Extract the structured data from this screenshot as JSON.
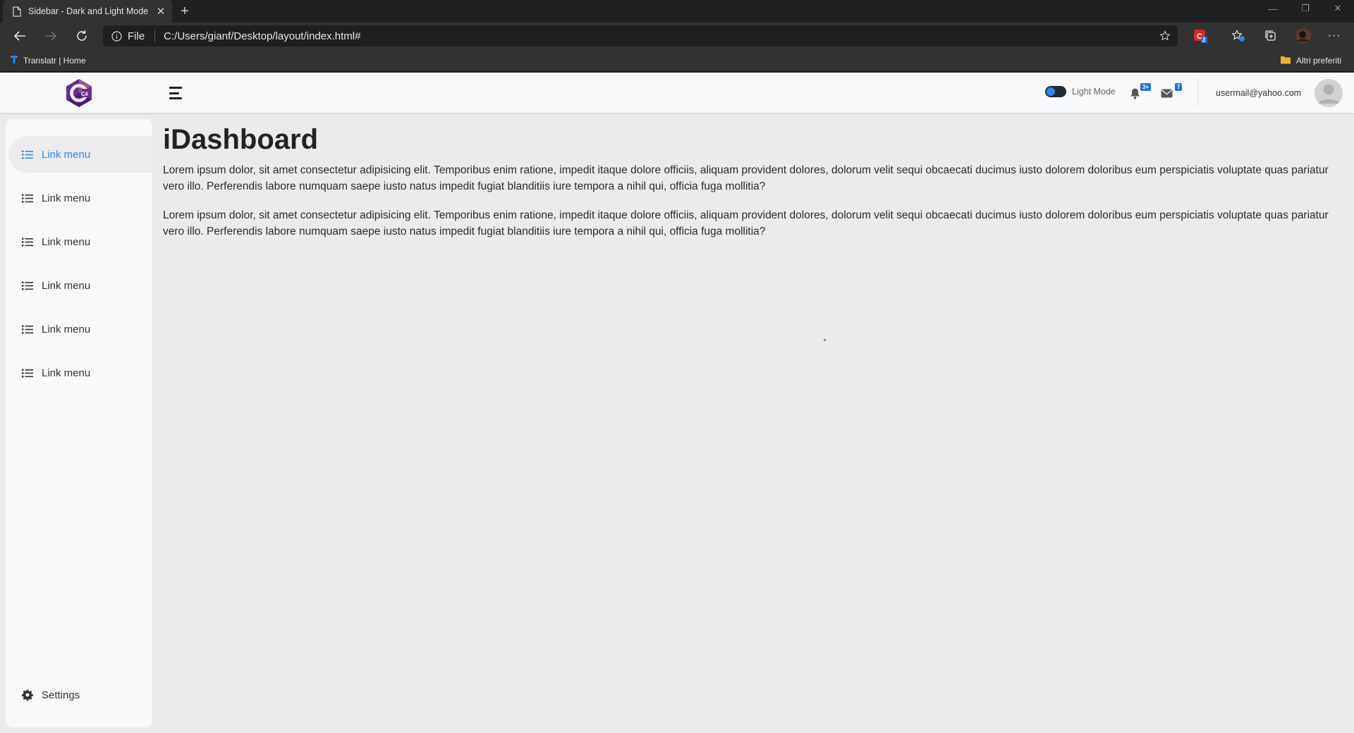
{
  "browser": {
    "tab_title": "Sidebar - Dark and Light Mode",
    "address_scheme": "File",
    "address_url": "C:/Users/gianf/Desktop/layout/index.html#",
    "bookmarks": [
      {
        "label": "Translatr | Home"
      }
    ],
    "other_bookmarks": "Altri preferiti",
    "extension_badge": "2"
  },
  "navbar": {
    "mode_label": "Light Mode",
    "notifications_badge": "3+",
    "messages_badge": "7",
    "user_email": "usermail@yahoo.com",
    "logo_text": "C#"
  },
  "sidebar": {
    "items": [
      {
        "label": "Link menu",
        "active": true
      },
      {
        "label": "Link menu",
        "active": false
      },
      {
        "label": "Link menu",
        "active": false
      },
      {
        "label": "Link menu",
        "active": false
      },
      {
        "label": "Link menu",
        "active": false
      },
      {
        "label": "Link menu",
        "active": false
      }
    ],
    "settings_label": "Settings"
  },
  "main": {
    "title": "iDashboard",
    "paragraphs": [
      "Lorem ipsum dolor, sit amet consectetur adipisicing elit. Temporibus enim ratione, impedit itaque dolore officiis, aliquam provident dolores, dolorum velit sequi obcaecati ducimus iusto dolorem doloribus eum perspiciatis voluptate quas pariatur vero illo. Perferendis labore numquam saepe iusto natus impedit fugiat blanditiis iure tempora a nihil qui, officia fuga mollitia?",
      "Lorem ipsum dolor, sit amet consectetur adipisicing elit. Temporibus enim ratione, impedit itaque dolore officiis, aliquam provident dolores, dolorum velit sequi obcaecati ducimus iusto dolorem doloribus eum perspiciatis voluptate quas pariatur vero illo. Perferendis labore numquam saepe iusto natus impedit fugiat blanditiis iure tempora a nihil qui, officia fuga mollitia?"
    ]
  },
  "colors": {
    "accent": "#2f86e0",
    "badge": "#1d73d6",
    "page_bg": "#ebebeb",
    "sidebar_bg": "#f8f9fb",
    "logo": "#6a2c91"
  }
}
